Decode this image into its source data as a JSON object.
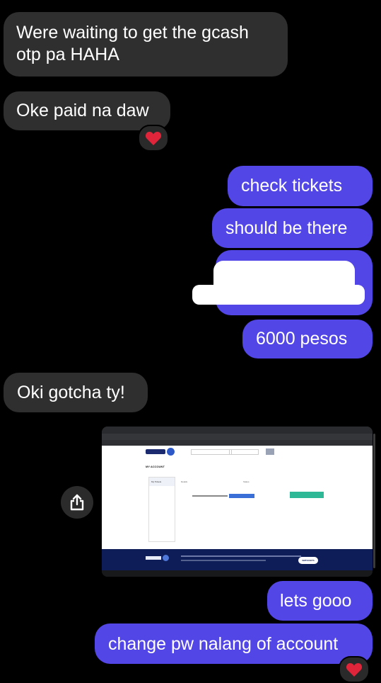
{
  "messages": [
    {
      "id": "m1",
      "direction": "incoming",
      "lines": [
        "Were waiting to get the gcash",
        "otp pa HAHA"
      ]
    },
    {
      "id": "m2",
      "direction": "incoming",
      "text": "Oke paid na daw",
      "reaction": "heart"
    },
    {
      "id": "m3",
      "direction": "outgoing",
      "text": "check tickets"
    },
    {
      "id": "m4",
      "direction": "outgoing",
      "text": "should be there"
    },
    {
      "id": "m5",
      "direction": "outgoing",
      "text": "",
      "redacted": true
    },
    {
      "id": "m6",
      "direction": "outgoing",
      "text": "6000 pesos"
    },
    {
      "id": "m7",
      "direction": "incoming",
      "text": "Oki gotcha ty!"
    },
    {
      "id": "m8",
      "direction": "outgoing",
      "type": "image"
    },
    {
      "id": "m9",
      "direction": "outgoing",
      "text": "lets gooo"
    },
    {
      "id": "m10",
      "direction": "outgoing",
      "text": "change pw nalang of account",
      "reaction": "heart"
    }
  ],
  "screenshot": {
    "page_heading": "MY ACCOUNT",
    "sidebar_active": "My Tickets",
    "col_a": "Details",
    "col_b": "Status",
    "footer_badge": "SMTICKETS"
  },
  "colors": {
    "outgoing": "#5346e6",
    "incoming": "#2f2f2f",
    "heart": "#e0253a"
  },
  "icons": {
    "reaction": "heart-icon",
    "share": "share-icon"
  }
}
